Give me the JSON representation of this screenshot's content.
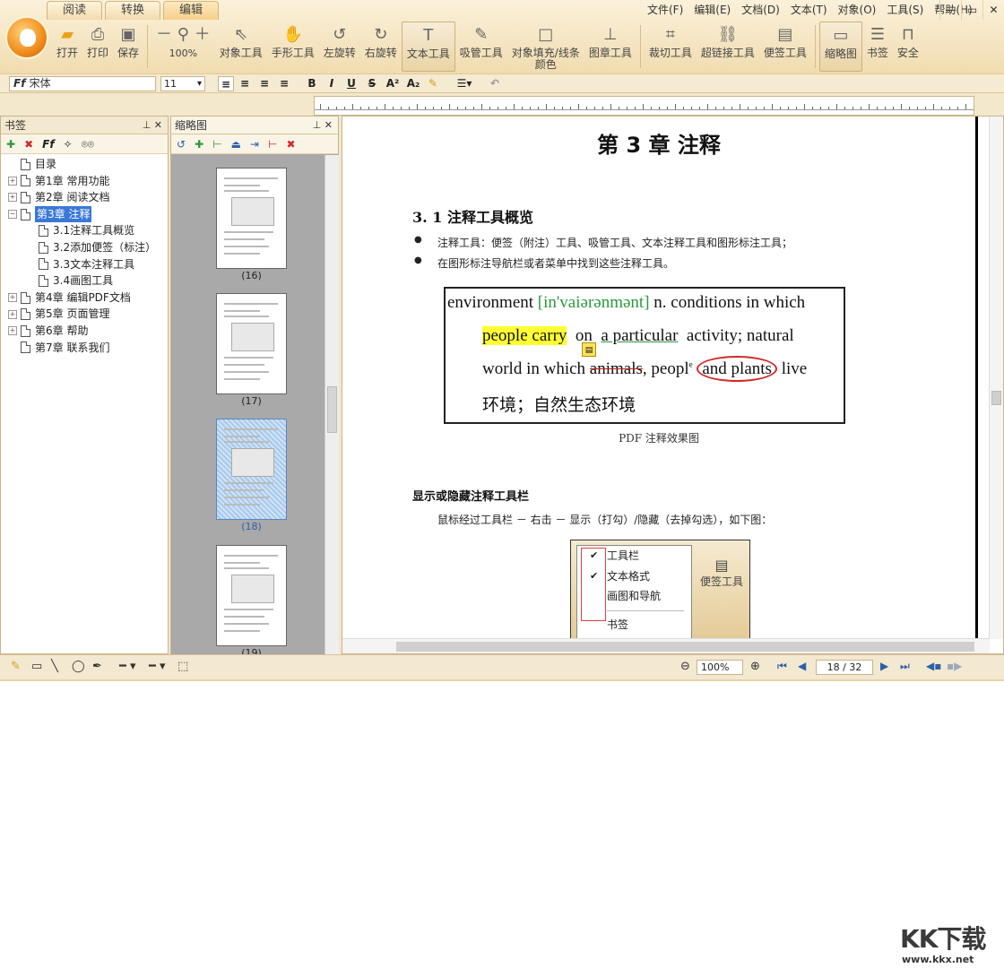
{
  "tabs": [
    "阅读",
    "转换",
    "编辑"
  ],
  "menus": [
    "文件(F)",
    "编辑(E)",
    "文档(D)",
    "文本(T)",
    "对象(O)",
    "工具(S)",
    "帮助(H)"
  ],
  "toolbar": {
    "open": "打开",
    "print": "打印",
    "save": "保存",
    "zoom": "100%",
    "object_tool": "对象工具",
    "hand_tool": "手形工具",
    "rotate_left": "左旋转",
    "rotate_right": "右旋转",
    "text_tool": "文本工具",
    "picker_tool": "吸管工具",
    "fill_color_1": "对象填充/线条",
    "fill_color_2": "颜色",
    "stamp_tool": "图章工具",
    "crop_tool": "裁切工具",
    "link_tool": "超链接工具",
    "note_tool": "便签工具",
    "thumbnails": "缩略图",
    "bookmarks": "书签",
    "security": "安全"
  },
  "format": {
    "font": "宋体",
    "size": "11"
  },
  "bookmarks_panel": {
    "title": "书签",
    "items": [
      {
        "label": "目录",
        "level": 0,
        "expander": ""
      },
      {
        "label": "第1章 常用功能",
        "level": 0,
        "expander": "+"
      },
      {
        "label": "第2章 阅读文档",
        "level": 0,
        "expander": "+"
      },
      {
        "label": "第3章 注释",
        "level": 0,
        "expander": "−",
        "selected": true
      },
      {
        "label": "3.1注释工具概览",
        "level": 1,
        "expander": ""
      },
      {
        "label": "3.2添加便签（标注）",
        "level": 1,
        "expander": ""
      },
      {
        "label": "3.3文本注释工具",
        "level": 1,
        "expander": ""
      },
      {
        "label": "3.4画图工具",
        "level": 1,
        "expander": ""
      },
      {
        "label": "第4章 编辑PDF文档",
        "level": 0,
        "expander": "+"
      },
      {
        "label": "第5章 页面管理",
        "level": 0,
        "expander": "+"
      },
      {
        "label": "第6章 帮助",
        "level": 0,
        "expander": "+"
      },
      {
        "label": "第7章 联系我们",
        "level": 0,
        "expander": ""
      }
    ]
  },
  "thumbs_panel": {
    "title": "缩略图",
    "pages": [
      "(16)",
      "(17)",
      "(18)",
      "(19)"
    ],
    "selected_page": "(18)"
  },
  "document": {
    "chapter": "第 3 章 注释",
    "section": "3. 1 注释工具概览",
    "bullets": [
      "注释工具：便签（附注）工具、吸管工具、文本注释工具和图形标注工具；",
      "在图形标注导航栏或者菜单中找到这些注释工具。"
    ],
    "example": {
      "w1": "environment",
      "phon": "[in'vaiərənmənt]",
      "w2": "n. conditions in which",
      "yellow": "people carry",
      "on": "on",
      "underline": "a particular",
      "w3": "activity; natural",
      "w4": "world in which",
      "strike": "animals",
      "w5": ", peopl",
      "sup": "e",
      "circled": "and plants",
      "w6": "live",
      "cn": "环境；自然生态环境"
    },
    "caption": "PDF 注释效果图",
    "heading2": "显示或隐藏注释工具栏",
    "para": "鼠标经过工具栏 － 右击 － 显示（打勾）/隐藏（去掉勾选），如下图：",
    "context_menu": [
      "工具栏",
      "文本格式",
      "画图和导航",
      "书签"
    ],
    "shot_tool": "便签工具"
  },
  "statusbar": {
    "zoom": "100%",
    "page": "18 / 32"
  },
  "watermark": {
    "logo": "KK下载",
    "url": "www.kkx.net"
  }
}
